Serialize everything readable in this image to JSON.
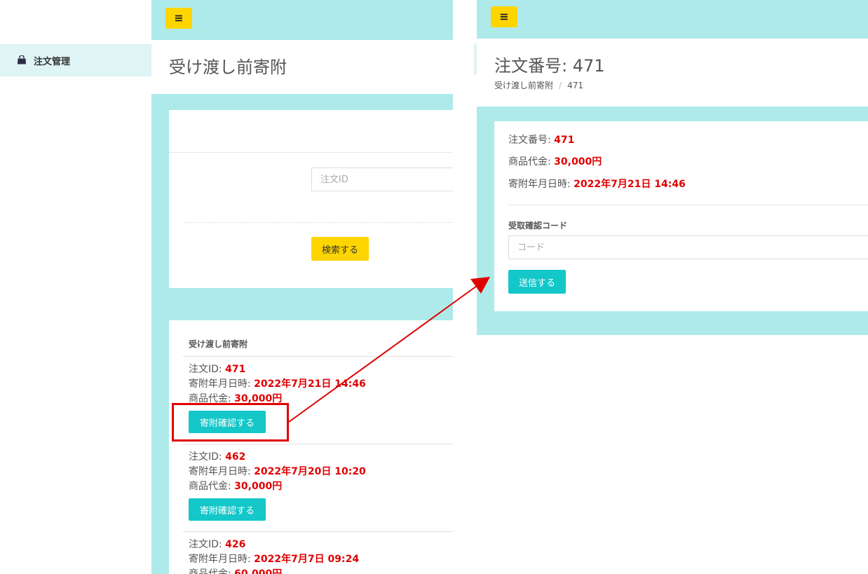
{
  "sidebar": {
    "items": [
      {
        "label": "注文管理",
        "icon": "shopping-bag-icon",
        "active": true
      }
    ]
  },
  "left_page": {
    "title": "受け渡し前寄附",
    "search": {
      "order_id_placeholder": "注文ID",
      "search_button": "検索する"
    },
    "list": {
      "header": "受け渡し前寄附",
      "labels": {
        "order_id": "注文ID:",
        "donation_datetime": "寄附年月日時:",
        "price": "商品代金:"
      },
      "items": [
        {
          "order_id": "471",
          "donation_datetime": "2022年7月21日 14:46",
          "price": "30,000円",
          "button": "寄附確認する"
        },
        {
          "order_id": "462",
          "donation_datetime": "2022年7月20日 10:20",
          "price": "30,000円",
          "button": "寄附確認する"
        },
        {
          "order_id": "426",
          "donation_datetime": "2022年7月7日 09:24",
          "price": "60,000円"
        }
      ]
    }
  },
  "right_page": {
    "title": "注文番号: 471",
    "breadcrumb": {
      "parent": "受け渡し前寄附",
      "separator": "/",
      "current": "471"
    },
    "detail": {
      "order_number_label": "注文番号:",
      "order_number": "471",
      "price_label": "商品代金:",
      "price": "30,000円",
      "datetime_label": "寄附年月日時:",
      "datetime": "2022年7月21日 14:46"
    },
    "code_form": {
      "label": "受取確認コード",
      "placeholder": "コード",
      "submit_button": "送信する"
    }
  },
  "colors": {
    "header_teal": "#aeeaea",
    "sidebar_active": "#dff4f4",
    "menu_button_yellow": "#ffd500",
    "action_button_teal": "#14c7c9",
    "value_red": "#e00000",
    "annotation_red": "#e00000"
  },
  "icons": {
    "menu": "hamburger-menu-icon",
    "annotation": "red-arrow"
  }
}
